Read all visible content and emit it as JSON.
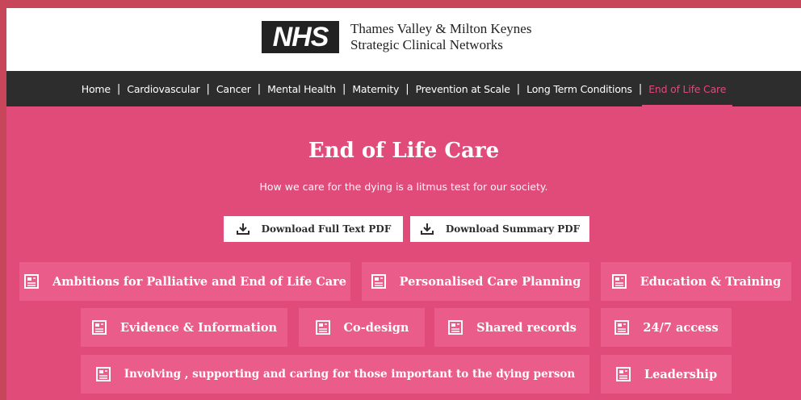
{
  "header": {
    "logo_text": "NHS",
    "org_line1": "Thames Valley & Milton Keynes",
    "org_line2": "Strategic Clinical Networks"
  },
  "nav": {
    "items": [
      {
        "label": "Home"
      },
      {
        "label": "Cardiovascular"
      },
      {
        "label": "Cancer"
      },
      {
        "label": "Mental Health"
      },
      {
        "label": "Maternity"
      },
      {
        "label": "Prevention at Scale"
      },
      {
        "label": "Long Term Conditions"
      },
      {
        "label": "End of Life Care",
        "active": true
      }
    ],
    "separator": "|"
  },
  "hero": {
    "title": "End of Life Care",
    "subtitle": "How we care for the dying is a litmus test for our society."
  },
  "downloads": {
    "full_label": "Download Full Text PDF",
    "summary_label": "Download Summary PDF"
  },
  "topics": [
    {
      "label": "Ambitions for Palliative and End of Life Care"
    },
    {
      "label": "Personalised Care Planning"
    },
    {
      "label": "Education & Training"
    },
    {
      "label": "Evidence & Information"
    },
    {
      "label": "Co-design"
    },
    {
      "label": "Shared records"
    },
    {
      "label": "24/7 access"
    },
    {
      "label": "Involving , supporting and caring for those important to the dying person"
    },
    {
      "label": "Leadership"
    }
  ],
  "colors": {
    "brand_pink": "#e04b79",
    "tile_pink": "#ea5d8a",
    "nav_bg": "#2d2d2d"
  },
  "icons": {
    "download": "download-icon",
    "topic": "document-icon"
  }
}
